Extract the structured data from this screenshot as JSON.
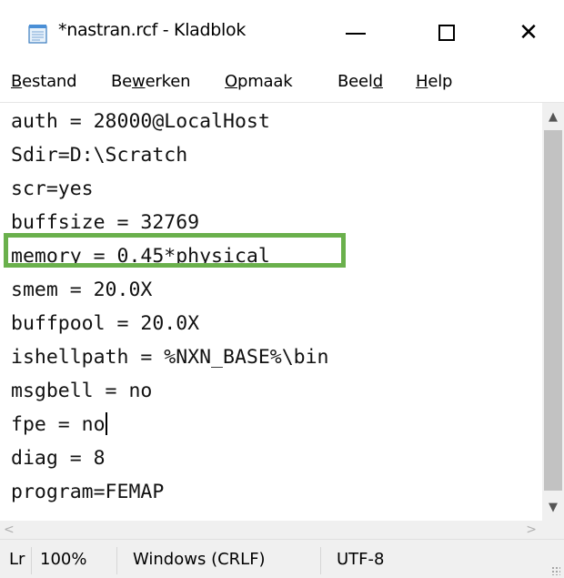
{
  "window": {
    "title": "*nastran.rcf - Kladblok",
    "icon": "notepad-icon",
    "controls": {
      "minimize": "minimize-icon",
      "maximize": "maximize-icon",
      "close": "close-icon",
      "close_glyph": "✕"
    }
  },
  "menu": {
    "items": [
      {
        "pre": "",
        "u": "B",
        "post": "estand"
      },
      {
        "pre": "Be",
        "u": "w",
        "post": "erken"
      },
      {
        "pre": "",
        "u": "O",
        "post": "pmaak"
      },
      {
        "pre": "Beel",
        "u": "d",
        "post": ""
      },
      {
        "pre": "",
        "u": "H",
        "post": "elp"
      }
    ]
  },
  "editor": {
    "lines": [
      "auth = 28000@LocalHost",
      "Sdir=D:\\Scratch",
      "scr=yes",
      "buffsize = 32769",
      "memory = 0.45*physical",
      "smem = 20.0X",
      "buffpool = 20.0X",
      "ishellpath = %NXN_BASE%\\bin",
      "msgbell = no",
      "fpe = no",
      "diag = 8",
      "program=FEMAP"
    ],
    "highlight_color": "#6ab04c"
  },
  "scrollbars": {
    "up_arrow": "▲",
    "down_arrow": "▼",
    "left_arrow": "<",
    "right_arrow": ">"
  },
  "status": {
    "position": "Lr",
    "zoom": "100%",
    "line_ending": "Windows (CRLF)",
    "encoding": "UTF-8"
  }
}
